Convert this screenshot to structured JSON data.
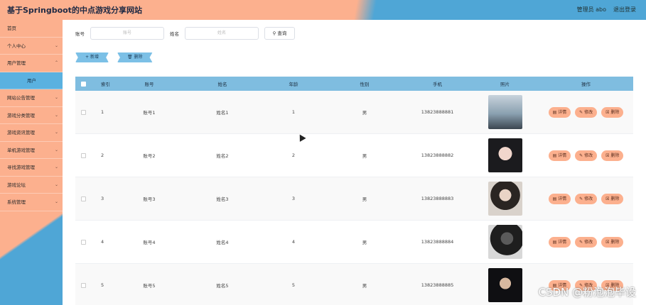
{
  "header": {
    "title": "基于Springboot的中点游戏分享网站",
    "user_label": "管理员 abo",
    "logout_label": "退出登录"
  },
  "sidebar": {
    "items": [
      {
        "label": "首页"
      },
      {
        "label": "个人中心"
      },
      {
        "label": "用户管理"
      },
      {
        "label": "用户"
      },
      {
        "label": "网站公告管理"
      },
      {
        "label": "游戏分类管理"
      },
      {
        "label": "游戏资讯管理"
      },
      {
        "label": "单机游戏管理"
      },
      {
        "label": "寻找游戏管理"
      },
      {
        "label": "游戏论坛"
      },
      {
        "label": "系统管理"
      }
    ]
  },
  "search": {
    "account_label": "账号",
    "account_placeholder": "账号",
    "name_label": "姓名",
    "name_placeholder": "姓名",
    "query_label": "查询"
  },
  "actions": {
    "add_label": "新增",
    "delete_label": "删除"
  },
  "table": {
    "headers": [
      "索引",
      "账号",
      "姓名",
      "年龄",
      "性别",
      "手机",
      "照片",
      "操作"
    ],
    "ops": {
      "detail": "详情",
      "edit": "修改",
      "delete": "删除"
    },
    "rows": [
      {
        "idx": "1",
        "account": "账号1",
        "name": "姓名1",
        "age": "1",
        "sex": "男",
        "phone": "13823888881"
      },
      {
        "idx": "2",
        "account": "账号2",
        "name": "姓名2",
        "age": "2",
        "sex": "男",
        "phone": "13823888882"
      },
      {
        "idx": "3",
        "account": "账号3",
        "name": "姓名3",
        "age": "3",
        "sex": "男",
        "phone": "13823888883"
      },
      {
        "idx": "4",
        "account": "账号4",
        "name": "姓名4",
        "age": "4",
        "sex": "男",
        "phone": "13823888884"
      },
      {
        "idx": "5",
        "account": "账号5",
        "name": "姓名5",
        "age": "5",
        "sex": "男",
        "phone": "13823888885"
      }
    ]
  },
  "watermark": "CSDN @粉泡泡毕设",
  "colors": {
    "header_orange": "#fcb08e",
    "header_blue": "#4fa6d6",
    "table_header": "#7fbde0",
    "op_button": "#fcb08e"
  }
}
